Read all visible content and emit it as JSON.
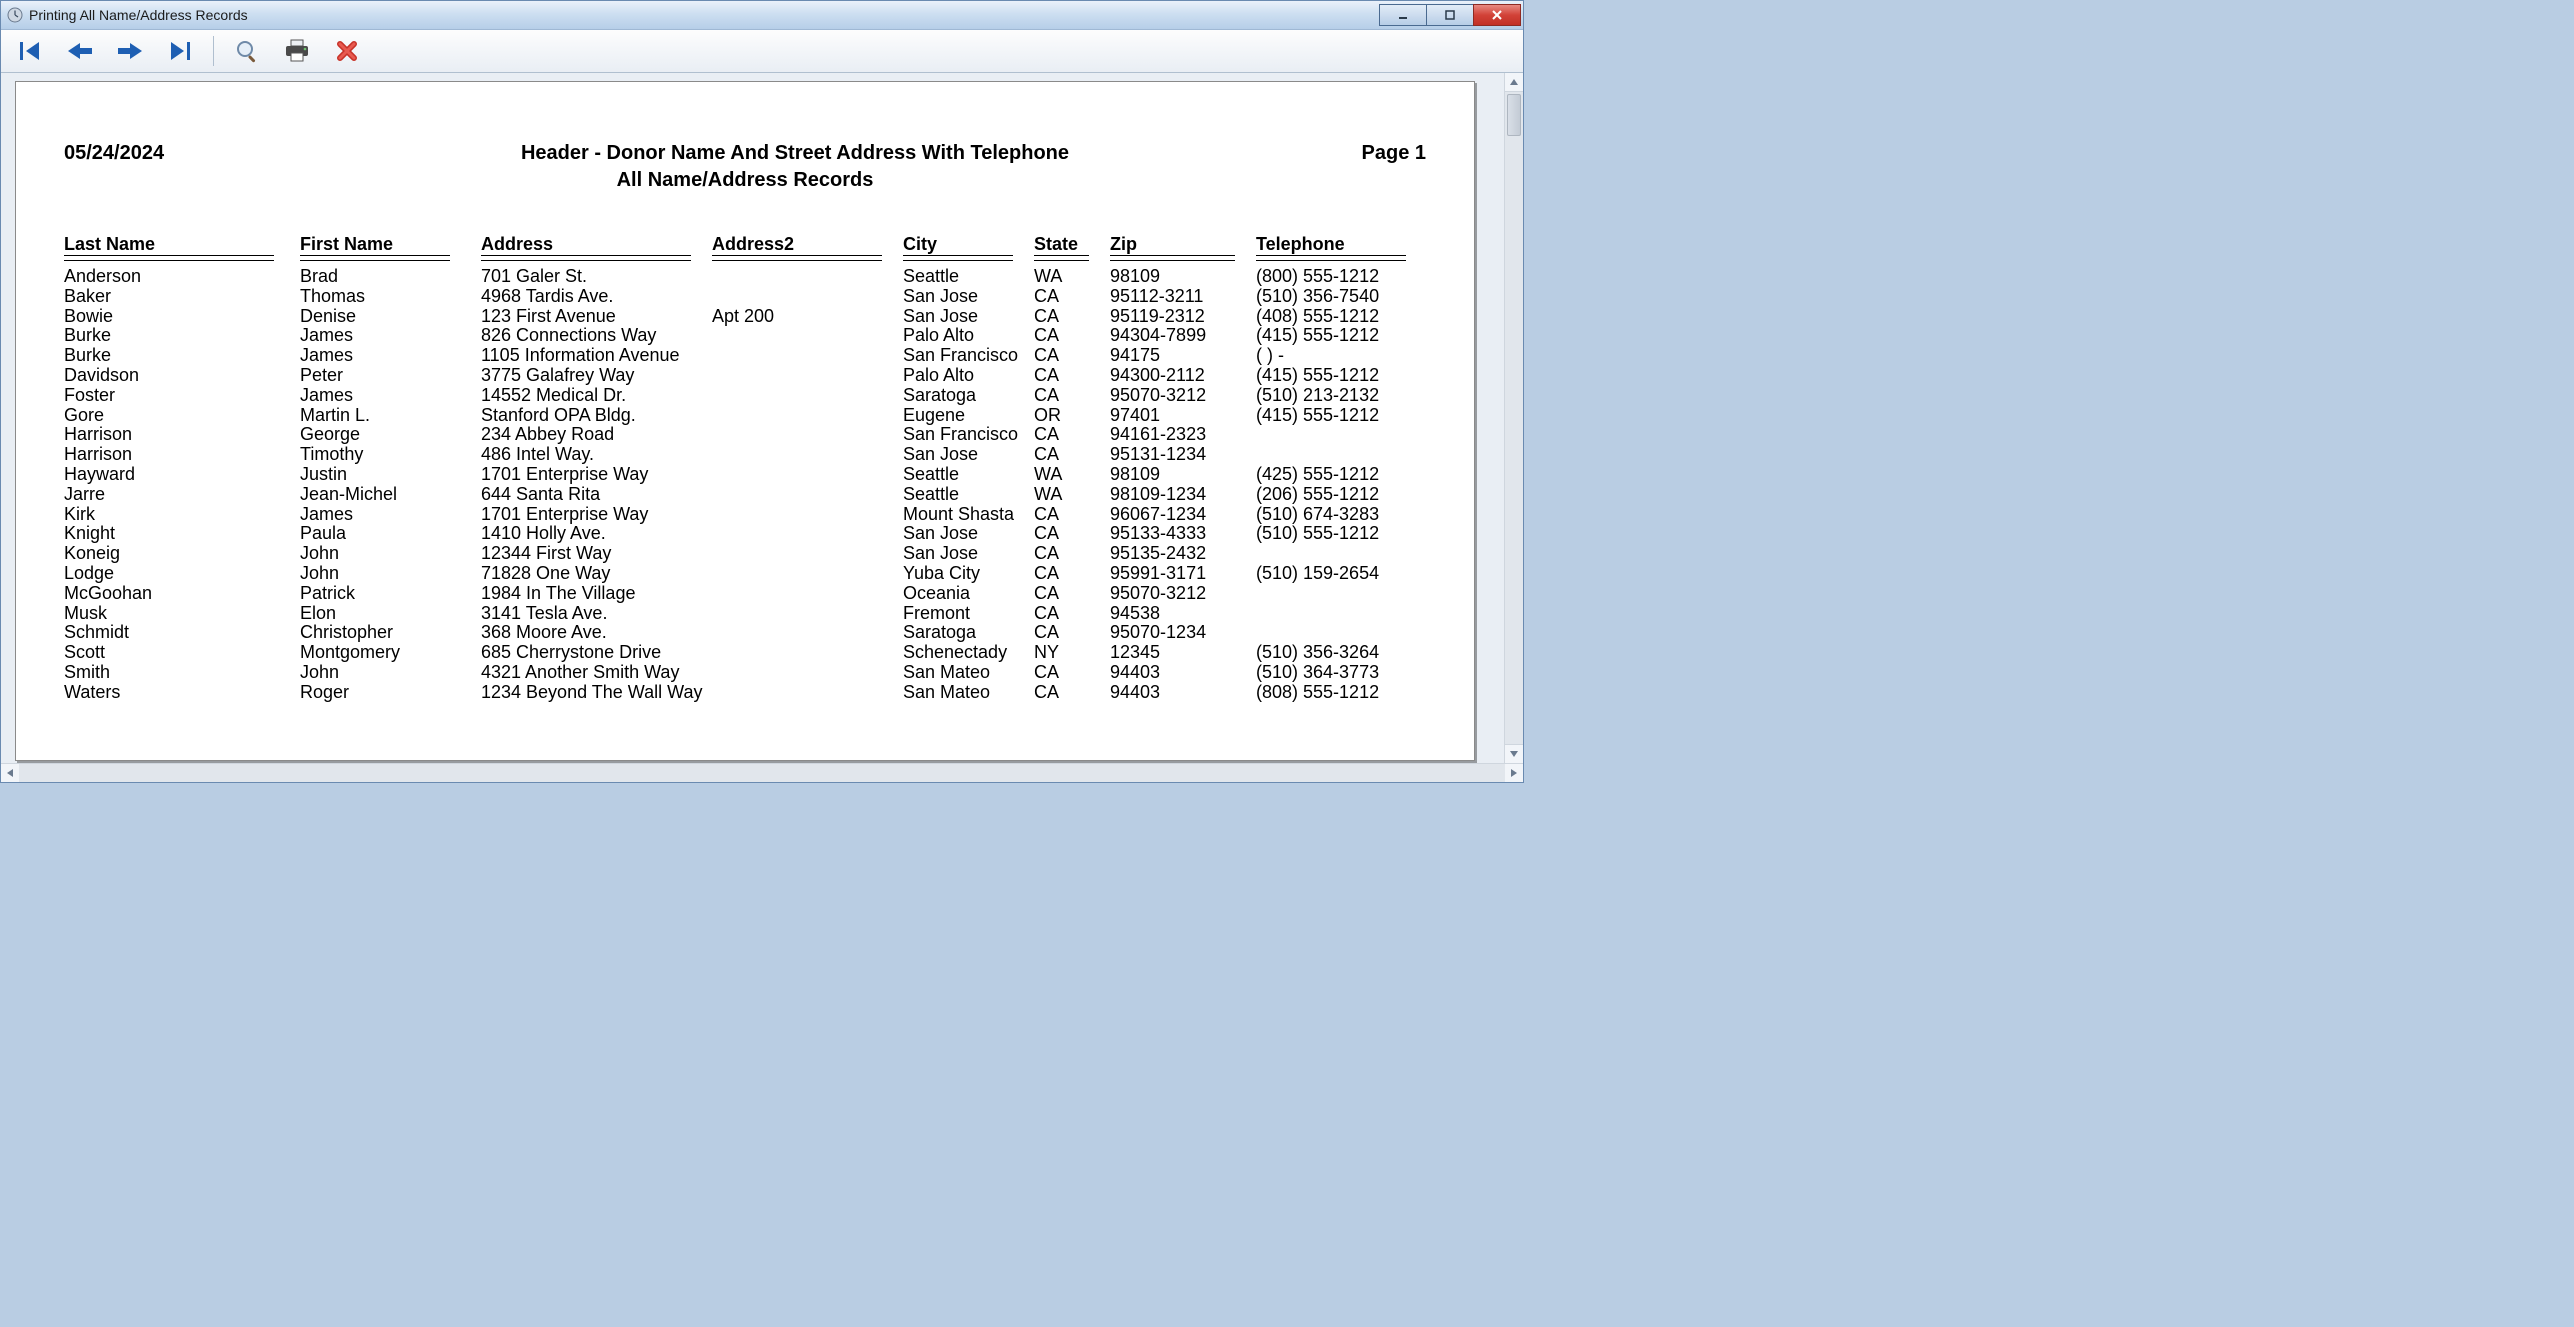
{
  "window": {
    "title": "Printing All Name/Address Records"
  },
  "report": {
    "date": "05/24/2024",
    "title": "Header - Donor Name And Street Address With Telephone",
    "subtitle": "All Name/Address Records",
    "page_label": "Page 1"
  },
  "columns": {
    "last": "Last Name",
    "first": "First Name",
    "addr": "Address",
    "addr2": "Address2",
    "city": "City",
    "state": "State",
    "zip": "Zip",
    "tel": "Telephone"
  },
  "rows": [
    {
      "last": "Anderson",
      "first": "Brad",
      "addr": "701 Galer St.",
      "addr2": "",
      "city": "Seattle",
      "state": "WA",
      "zip": "98109",
      "tel": "(800) 555-1212"
    },
    {
      "last": "Baker",
      "first": "Thomas",
      "addr": "4968 Tardis Ave.",
      "addr2": "",
      "city": "San Jose",
      "state": "CA",
      "zip": "95112-3211",
      "tel": "(510) 356-7540"
    },
    {
      "last": "Bowie",
      "first": "Denise",
      "addr": "123 First Avenue",
      "addr2": "Apt 200",
      "city": "San Jose",
      "state": "CA",
      "zip": "95119-2312",
      "tel": "(408) 555-1212"
    },
    {
      "last": "Burke",
      "first": "James",
      "addr": "826 Connections Way",
      "addr2": "",
      "city": "Palo Alto",
      "state": "CA",
      "zip": "94304-7899",
      "tel": "(415) 555-1212"
    },
    {
      "last": "Burke",
      "first": "James",
      "addr": "1105 Information Avenue",
      "addr2": "",
      "city": "San Francisco",
      "state": "CA",
      "zip": "94175",
      "tel": "(    )    -"
    },
    {
      "last": "Davidson",
      "first": "Peter",
      "addr": "3775 Galafrey Way",
      "addr2": "",
      "city": "Palo Alto",
      "state": "CA",
      "zip": "94300-2112",
      "tel": "(415) 555-1212"
    },
    {
      "last": "Foster",
      "first": "James",
      "addr": "14552 Medical Dr.",
      "addr2": "",
      "city": "Saratoga",
      "state": "CA",
      "zip": "95070-3212",
      "tel": "(510) 213-2132"
    },
    {
      "last": "Gore",
      "first": "Martin L.",
      "addr": "Stanford OPA Bldg.",
      "addr2": "",
      "city": "Eugene",
      "state": "OR",
      "zip": "97401",
      "tel": "(415) 555-1212"
    },
    {
      "last": "Harrison",
      "first": "George",
      "addr": "234 Abbey Road",
      "addr2": "",
      "city": "San Francisco",
      "state": "CA",
      "zip": "94161-2323",
      "tel": ""
    },
    {
      "last": "Harrison",
      "first": "Timothy",
      "addr": "486 Intel Way.",
      "addr2": "",
      "city": "San Jose",
      "state": "CA",
      "zip": "95131-1234",
      "tel": ""
    },
    {
      "last": "Hayward",
      "first": "Justin",
      "addr": "1701 Enterprise Way",
      "addr2": "",
      "city": "Seattle",
      "state": "WA",
      "zip": "98109",
      "tel": "(425) 555-1212"
    },
    {
      "last": "Jarre",
      "first": "Jean-Michel",
      "addr": "644 Santa Rita",
      "addr2": "",
      "city": "Seattle",
      "state": "WA",
      "zip": "98109-1234",
      "tel": "(206) 555-1212"
    },
    {
      "last": "Kirk",
      "first": "James",
      "addr": "1701 Enterprise Way",
      "addr2": "",
      "city": "Mount Shasta",
      "state": "CA",
      "zip": "96067-1234",
      "tel": "(510) 674-3283"
    },
    {
      "last": "Knight",
      "first": "Paula",
      "addr": "1410 Holly Ave.",
      "addr2": "",
      "city": "San Jose",
      "state": "CA",
      "zip": "95133-4333",
      "tel": "(510) 555-1212"
    },
    {
      "last": "Koneig",
      "first": "John",
      "addr": "12344 First Way",
      "addr2": "",
      "city": "San Jose",
      "state": "CA",
      "zip": "95135-2432",
      "tel": ""
    },
    {
      "last": "Lodge",
      "first": "John",
      "addr": "71828 One Way",
      "addr2": "",
      "city": "Yuba City",
      "state": "CA",
      "zip": "95991-3171",
      "tel": "(510) 159-2654"
    },
    {
      "last": "McGoohan",
      "first": "Patrick",
      "addr": "1984 In The Village",
      "addr2": "",
      "city": "Oceania",
      "state": "CA",
      "zip": "95070-3212",
      "tel": ""
    },
    {
      "last": "Musk",
      "first": "Elon",
      "addr": "3141 Tesla Ave.",
      "addr2": "",
      "city": "Fremont",
      "state": "CA",
      "zip": "94538",
      "tel": ""
    },
    {
      "last": "Schmidt",
      "first": "Christopher",
      "addr": "368 Moore Ave.",
      "addr2": "",
      "city": "Saratoga",
      "state": "CA",
      "zip": "95070-1234",
      "tel": ""
    },
    {
      "last": "Scott",
      "first": "Montgomery",
      "addr": "685 Cherrystone Drive",
      "addr2": "",
      "city": "Schenectady",
      "state": "NY",
      "zip": "12345",
      "tel": "(510) 356-3264"
    },
    {
      "last": "Smith",
      "first": "John",
      "addr": "4321 Another Smith Way",
      "addr2": "",
      "city": "San Mateo",
      "state": "CA",
      "zip": "94403",
      "tel": "(510) 364-3773"
    },
    {
      "last": "Waters",
      "first": "Roger",
      "addr": "1234 Beyond The Wall Way",
      "addr2": "",
      "city": "San Mateo",
      "state": "CA",
      "zip": "94403",
      "tel": "(808) 555-1212"
    }
  ]
}
